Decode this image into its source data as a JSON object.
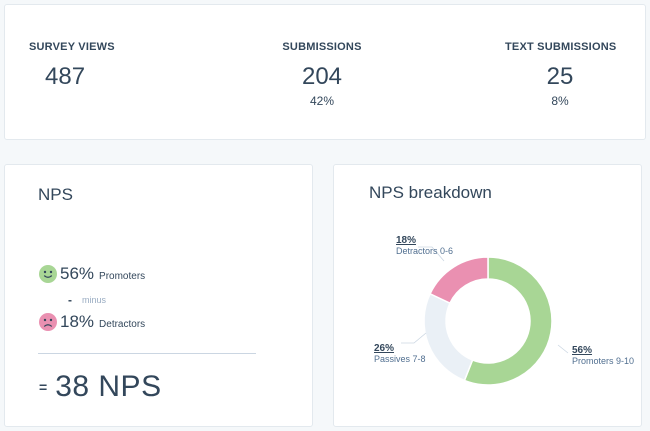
{
  "stats": [
    {
      "label": "SURVEY VIEWS",
      "value": "487",
      "sub": ""
    },
    {
      "label": "SUBMISSIONS",
      "value": "204",
      "sub": "42%"
    },
    {
      "label": "TEXT SUBMISSIONS",
      "value": "25",
      "sub": "8%"
    }
  ],
  "nps": {
    "title": "NPS",
    "promoters_pct": "56%",
    "promoters_label": "Promoters",
    "minus_sign": "-",
    "minus_text": "minus",
    "detractors_pct": "18%",
    "detractors_label": "Detractors",
    "result_sign": "=",
    "result": "38 NPS",
    "promoter_icon": "smiley-face-icon",
    "detractor_icon": "frowning-face-icon",
    "promoter_color": "#a8d695",
    "detractor_color": "#ea90b1"
  },
  "breakdown": {
    "title": "NPS breakdown",
    "legend": [
      {
        "pct": "18%",
        "label": "Detractors 0-6"
      },
      {
        "pct": "26%",
        "label": "Passives 7-8"
      },
      {
        "pct": "56%",
        "label": "Promoters 9-10"
      }
    ]
  },
  "chart_data": {
    "type": "pie",
    "style": "donut",
    "title": "NPS breakdown",
    "categories": [
      "Promoters 9-10",
      "Passives 7-8",
      "Detractors 0-6"
    ],
    "values": [
      56,
      26,
      18
    ],
    "colors": [
      "#a8d695",
      "#eaf0f6",
      "#ea90b1"
    ]
  }
}
